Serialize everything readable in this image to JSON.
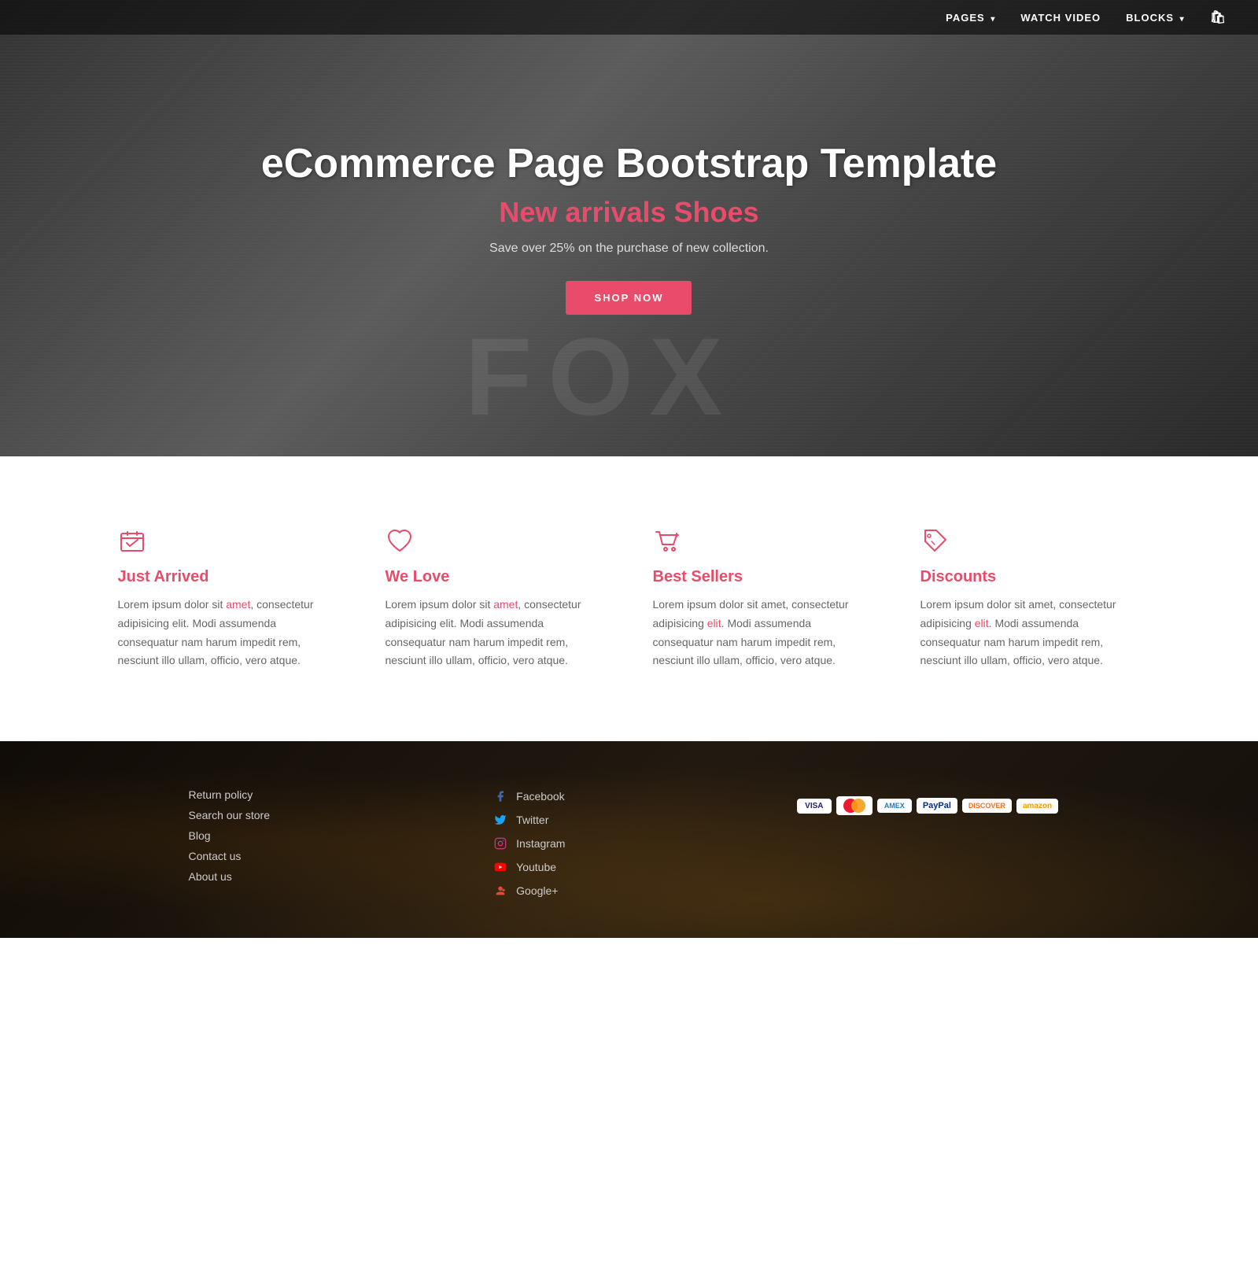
{
  "nav": {
    "pages_label": "PAGES",
    "watch_video_label": "WATCH VIDEO",
    "blocks_label": "BLOCKS",
    "cart_icon": "cart"
  },
  "hero": {
    "title": "eCommerce Page Bootstrap Template",
    "subtitle_prefix": "New arrivals ",
    "subtitle_highlight": "Shoes",
    "description": "Save over 25% on the purchase of new collection.",
    "cta_label": "SHOP NOW",
    "fox_text": "FOX"
  },
  "features": {
    "items": [
      {
        "id": "just-arrived",
        "icon": "arrived",
        "title": "Just Arrived",
        "text": "Lorem ipsum dolor sit amet, consectetur adipisicing elit. Modi assumenda consequatur nam harum impedit rem, nesciunt illo ullam, officio, vero atque.",
        "highlight_word": "amet"
      },
      {
        "id": "we-love",
        "icon": "heart",
        "title": "We Love",
        "text": "Lorem ipsum dolor sit amet, consectetur adipisicing elit. Modi assumenda consequatur nam harum impedit rem, nesciunt illo ullam, officio, vero atque.",
        "highlight_word": "amet"
      },
      {
        "id": "best-sellers",
        "icon": "cart",
        "title": "Best Sellers",
        "text": "Lorem ipsum dolor sit amet, consectetur adipisicing elit. Modi assumenda consequatur nam harum impedit rem, nesciunt illo ullam, officio, vero atque.",
        "highlight_word": "elit"
      },
      {
        "id": "discounts",
        "icon": "tag",
        "title": "Discounts",
        "text": "Lorem ipsum dolor sit amet, consectetur adipisicing elit. Modi assumenda consequatur nam harum impedit rem, nesciunt illo ullam, officio, vero atque.",
        "highlight_word": "elit"
      }
    ]
  },
  "footer": {
    "links": [
      {
        "label": "Return policy",
        "id": "return-policy"
      },
      {
        "label": "Search our store",
        "id": "search-store"
      },
      {
        "label": "Blog",
        "id": "blog"
      },
      {
        "label": "Contact us",
        "id": "contact-us"
      },
      {
        "label": "About us",
        "id": "about-us"
      }
    ],
    "social": [
      {
        "label": "Facebook",
        "icon": "facebook",
        "id": "facebook"
      },
      {
        "label": "Twitter",
        "icon": "twitter",
        "id": "twitter"
      },
      {
        "label": "Instagram",
        "icon": "instagram",
        "id": "instagram"
      },
      {
        "label": "Youtube",
        "icon": "youtube",
        "id": "youtube"
      },
      {
        "label": "Google+",
        "icon": "googleplus",
        "id": "googleplus"
      }
    ],
    "payments": [
      {
        "label": "VISA",
        "type": "visa"
      },
      {
        "label": "MC",
        "type": "mastercard"
      },
      {
        "label": "AMEX",
        "type": "amex"
      },
      {
        "label": "PayPal",
        "type": "paypal"
      },
      {
        "label": "DISC",
        "type": "discover"
      },
      {
        "label": "amazon",
        "type": "amazon"
      }
    ]
  }
}
